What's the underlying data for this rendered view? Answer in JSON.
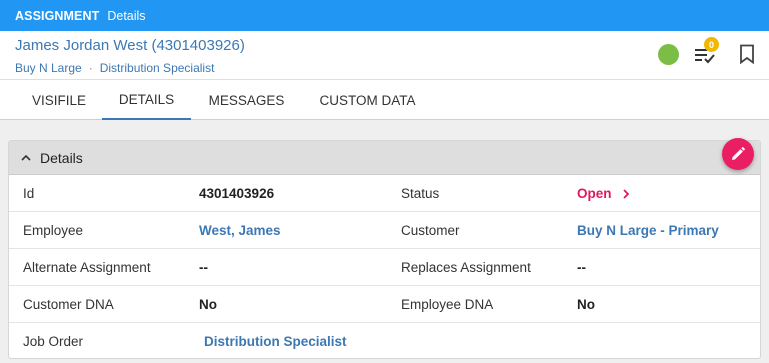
{
  "topbar": {
    "section": "ASSIGNMENT",
    "page": "Details"
  },
  "header": {
    "name": "James Jordan West (4301403926)",
    "company": "Buy N Large",
    "separator": "·",
    "position": "Distribution Specialist",
    "task_count": "0"
  },
  "tabs": [
    "VISIFILE",
    "DETAILS",
    "MESSAGES",
    "CUSTOM DATA"
  ],
  "panel": {
    "title": "Details"
  },
  "fields": {
    "id_label": "Id",
    "id_value": "4301403926",
    "status_label": "Status",
    "status_value": "Open",
    "employee_label": "Employee",
    "employee_value": "West, James",
    "customer_label": "Customer",
    "customer_value": "Buy N Large - Primary",
    "alt_label": "Alternate Assignment",
    "alt_value": "--",
    "replaces_label": "Replaces Assignment",
    "replaces_value": "--",
    "cust_dna_label": "Customer DNA",
    "cust_dna_value": "No",
    "emp_dna_label": "Employee DNA",
    "emp_dna_value": "No",
    "job_label": "Job Order",
    "job_value": "Distribution Specialist"
  },
  "colors": {
    "accent": "#2196f3",
    "link": "#3c78b4",
    "status_open": "#e0185f",
    "online": "#7cbd45",
    "fab": "#e91e63"
  }
}
